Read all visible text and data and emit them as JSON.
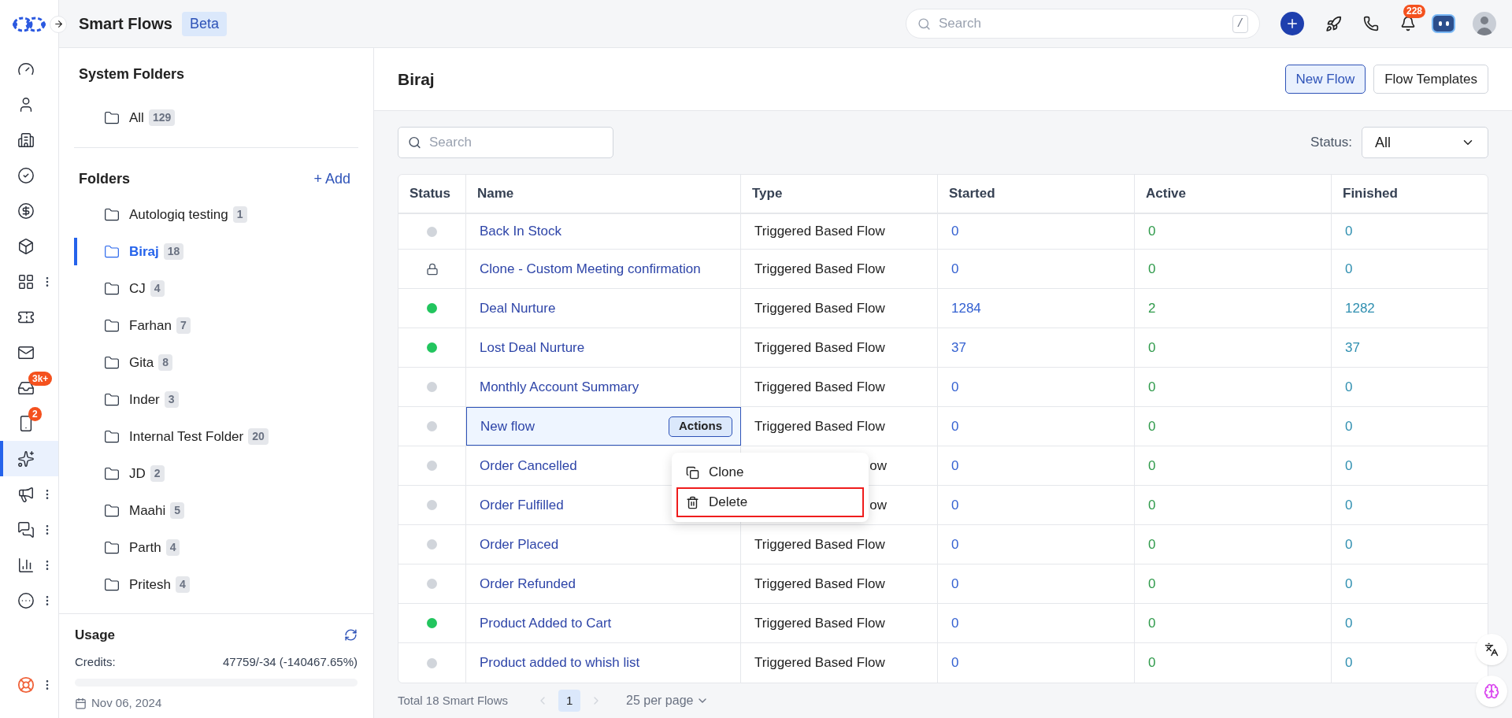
{
  "topbar": {
    "title": "Smart Flows",
    "badge": "Beta",
    "search": {
      "placeholder": "Search",
      "shortcut": "/"
    },
    "notifications": "228"
  },
  "rail": [
    {
      "selected": false,
      "menu": false
    },
    {
      "selected": false,
      "menu": false
    },
    {
      "selected": false,
      "menu": false
    },
    {
      "selected": false,
      "menu": false
    },
    {
      "selected": false,
      "menu": false
    },
    {
      "selected": false,
      "menu": false
    },
    {
      "selected": false,
      "menu": true
    },
    {
      "selected": false,
      "menu": false
    },
    {
      "selected": false,
      "menu": false
    },
    {
      "selected": false,
      "menu": false,
      "badge": "3k+"
    },
    {
      "selected": false,
      "menu": false,
      "badge": "2"
    },
    {
      "selected": true,
      "menu": false
    },
    {
      "selected": false,
      "menu": true
    },
    {
      "selected": false,
      "menu": true
    },
    {
      "selected": false,
      "menu": true
    },
    {
      "selected": false,
      "menu": true
    }
  ],
  "rail_bottom": {
    "menu": true
  },
  "system_folders": {
    "title": "System Folders",
    "items": [
      {
        "name": "All",
        "count": "129",
        "selected": false
      }
    ]
  },
  "folders": {
    "title": "Folders",
    "add": "+ Add",
    "items": [
      {
        "name": "Autologiq testing",
        "count": "1",
        "selected": false
      },
      {
        "name": "Biraj",
        "count": "18",
        "selected": true
      },
      {
        "name": "CJ",
        "count": "4",
        "selected": false
      },
      {
        "name": "Farhan",
        "count": "7",
        "selected": false
      },
      {
        "name": "Gita",
        "count": "8",
        "selected": false
      },
      {
        "name": "Inder",
        "count": "3",
        "selected": false
      },
      {
        "name": "Internal Test Folder",
        "count": "20",
        "selected": false
      },
      {
        "name": "JD",
        "count": "2",
        "selected": false
      },
      {
        "name": "Maahi",
        "count": "5",
        "selected": false
      },
      {
        "name": "Parth",
        "count": "4",
        "selected": false
      },
      {
        "name": "Pritesh",
        "count": "4",
        "selected": false
      }
    ]
  },
  "usage": {
    "title": "Usage",
    "label": "Credits:",
    "value": "47759/-34 (-140467.65%)",
    "level": 0,
    "date": "Nov 06, 2024"
  },
  "main": {
    "title": "Biraj",
    "buttons": [
      {
        "label": "New Flow",
        "kind": "primary"
      },
      {
        "label": "Flow Templates",
        "kind": "secondary"
      }
    ],
    "search": {
      "placeholder": "Search"
    },
    "status_filter": {
      "label": "Status:",
      "value": "All"
    }
  },
  "table": {
    "columns": [
      "Status",
      "Name",
      "Type",
      "Started",
      "Active",
      "Finished"
    ],
    "rows": [
      {
        "kind": "inactive",
        "name": "Back In Stock",
        "type": "Triggered Based Flow",
        "started": "0",
        "active": "0",
        "finished": "0",
        "selected": false
      },
      {
        "kind": "locked",
        "name": "Clone - Custom Meeting confirmation",
        "type": "Triggered Based Flow",
        "started": "0",
        "active": "0",
        "finished": "0",
        "selected": false
      },
      {
        "kind": "active",
        "name": "Deal Nurture",
        "type": "Triggered Based Flow",
        "started": "1284",
        "active": "2",
        "finished": "1282",
        "selected": false
      },
      {
        "kind": "active",
        "name": "Lost Deal Nurture",
        "type": "Triggered Based Flow",
        "started": "37",
        "active": "0",
        "finished": "37",
        "selected": false
      },
      {
        "kind": "inactive",
        "name": "Monthly Account Summary",
        "type": "Triggered Based Flow",
        "started": "0",
        "active": "0",
        "finished": "0",
        "selected": false
      },
      {
        "kind": "inactive",
        "name": "New flow",
        "type": "Triggered Based Flow",
        "started": "0",
        "active": "0",
        "finished": "0",
        "selected": true,
        "actions": "Actions"
      },
      {
        "kind": "inactive",
        "name": "Order Cancelled",
        "type": "ow",
        "type_covered": true,
        "started": "0",
        "active": "0",
        "finished": "0",
        "selected": false
      },
      {
        "kind": "inactive",
        "name": "Order Fulfilled",
        "type": "ow",
        "type_covered": true,
        "started": "0",
        "active": "0",
        "finished": "0",
        "selected": false
      },
      {
        "kind": "inactive",
        "name": "Order Placed",
        "type": "Triggered Based Flow",
        "started": "0",
        "active": "0",
        "finished": "0",
        "selected": false
      },
      {
        "kind": "inactive",
        "name": "Order Refunded",
        "type": "Triggered Based Flow",
        "started": "0",
        "active": "0",
        "finished": "0",
        "selected": false
      },
      {
        "kind": "active",
        "name": "Product Added to Cart",
        "type": "Triggered Based Flow",
        "started": "0",
        "active": "0",
        "finished": "0",
        "selected": false
      },
      {
        "kind": "inactive",
        "name": "Product added to whish list",
        "type": "Triggered Based Flow",
        "started": "0",
        "active": "0",
        "finished": "0",
        "selected": false
      }
    ]
  },
  "menu": {
    "items": [
      {
        "label": "Clone",
        "kind": "clone",
        "highlighted": false
      },
      {
        "label": "Delete",
        "kind": "delete",
        "highlighted": true
      }
    ]
  },
  "pagination": {
    "total": "Total 18 Smart Flows",
    "pages": [
      {
        "label": "1",
        "selected": true
      }
    ],
    "per_page": "25 per page"
  }
}
